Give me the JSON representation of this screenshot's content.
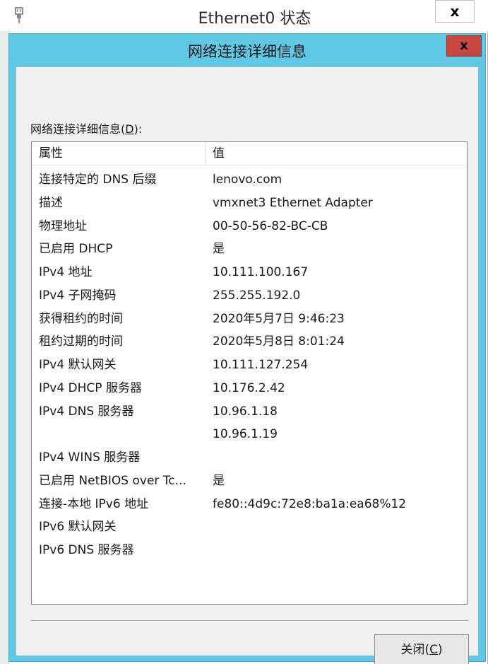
{
  "parent_window": {
    "title": "Ethernet0 状态",
    "close_label": "x"
  },
  "dialog": {
    "title": "网络连接详细信息",
    "close_label": "x",
    "group_label": "网络连接详细信息(",
    "group_mnemonic": "D",
    "group_label_end": "):",
    "columns": [
      "属性",
      "值"
    ],
    "rows": [
      {
        "property": "连接特定的 DNS 后缀",
        "value": "lenovo.com"
      },
      {
        "property": "描述",
        "value": "vmxnet3 Ethernet Adapter"
      },
      {
        "property": "物理地址",
        "value": "00-50-56-82-BC-CB"
      },
      {
        "property": "已启用 DHCP",
        "value": "是"
      },
      {
        "property": "IPv4 地址",
        "value": "10.111.100.167"
      },
      {
        "property": "IPv4 子网掩码",
        "value": "255.255.192.0"
      },
      {
        "property": "获得租约的时间",
        "value": "2020年5月7日 9:46:23"
      },
      {
        "property": "租约过期的时间",
        "value": "2020年5月8日 8:01:24"
      },
      {
        "property": "IPv4 默认网关",
        "value": "10.111.127.254"
      },
      {
        "property": "IPv4 DHCP 服务器",
        "value": "10.176.2.42"
      },
      {
        "property": "IPv4 DNS 服务器",
        "value": "10.96.1.18"
      },
      {
        "property": "",
        "value": "10.96.1.19"
      },
      {
        "property": "IPv4 WINS 服务器",
        "value": ""
      },
      {
        "property": "已启用 NetBIOS over Tc...",
        "value": "是"
      },
      {
        "property": "连接-本地 IPv6 地址",
        "value": "fe80::4d9c:72e8:ba1a:ea68%12"
      },
      {
        "property": "IPv6 默认网关",
        "value": ""
      },
      {
        "property": "IPv6 DNS 服务器",
        "value": ""
      }
    ],
    "close_button": {
      "label": "关闭(",
      "mnemonic": "C",
      "label_end": ")"
    }
  },
  "colors": {
    "dialog_frame": "#5fc8e4",
    "close_red": "#c7463f",
    "body_bg": "#f0f0f0"
  },
  "icons": {
    "parent_app": "network-adapter-icon"
  }
}
